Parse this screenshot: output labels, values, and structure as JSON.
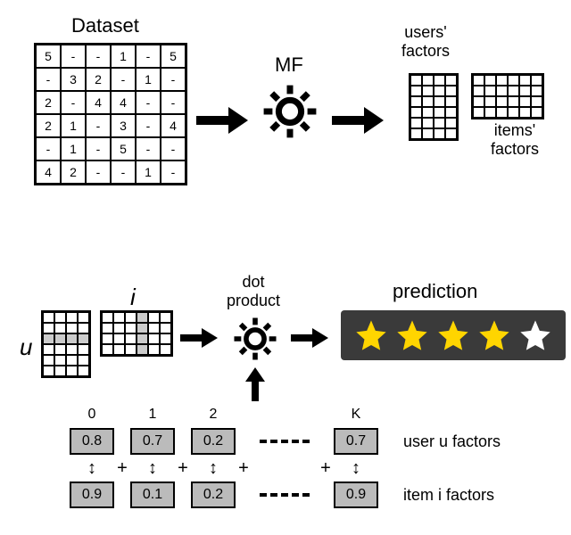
{
  "top": {
    "dataset_label": "Dataset",
    "matrix": [
      [
        "5",
        "-",
        "-",
        "1",
        "-",
        "5"
      ],
      [
        "-",
        "3",
        "2",
        "-",
        "1",
        "-"
      ],
      [
        "2",
        "-",
        "4",
        "4",
        "-",
        "-"
      ],
      [
        "2",
        "1",
        "-",
        "3",
        "-",
        "4"
      ],
      [
        "-",
        "1",
        "-",
        "5",
        "-",
        "-"
      ],
      [
        "4",
        "2",
        "-",
        "-",
        "1",
        "-"
      ]
    ],
    "mf_label": "MF",
    "users_factors_label": "users'\nfactors",
    "items_factors_label": "items'\nfactors"
  },
  "bottom": {
    "u_label": "u",
    "i_label": "i",
    "dot_label": "dot\nproduct",
    "prediction_label": "prediction",
    "rating": {
      "filled": 4,
      "total": 5
    },
    "indices": [
      "0",
      "1",
      "2",
      "K"
    ],
    "user_factors": [
      "0.8",
      "0.7",
      "0.2",
      "0.7"
    ],
    "item_factors": [
      "0.9",
      "0.1",
      "0.2",
      "0.9"
    ],
    "user_factors_label": "user u factors",
    "item_factors_label": "item i factors",
    "plus": "+"
  }
}
